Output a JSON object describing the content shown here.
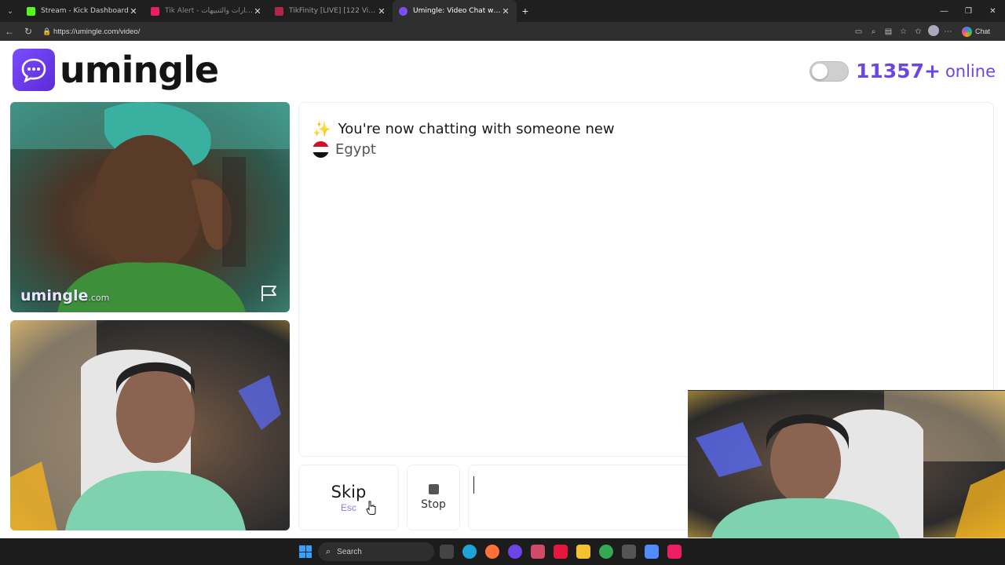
{
  "browser": {
    "tabs": [
      {
        "title": "Stream - Kick Dashboard",
        "icon": "kick-icon",
        "color": "#53fc18",
        "active": false
      },
      {
        "title": "Tik Alert - خدمة الإشعارات والتنبيهات",
        "icon": "tikalert-icon",
        "color": "#e91e63",
        "active": false
      },
      {
        "title": "TikFinity [LIVE] [122 Viewers]",
        "icon": "tikfinity-icon",
        "color": "#ff2d55",
        "active": false
      },
      {
        "title": "Umingle: Video Chat with Str...",
        "icon": "umingle-icon",
        "color": "#7c4dff",
        "active": true
      }
    ],
    "url": "https://umingle.com/video/",
    "copilot_label": "Chat"
  },
  "site": {
    "logo_text": "umingle",
    "online_count": "11357+",
    "online_label": "online",
    "brand_color": "#6b46e6"
  },
  "stranger_video": {
    "watermark": "umingle",
    "watermark_suffix": ".com"
  },
  "chat": {
    "intro_emoji": "✨",
    "intro": "You're now chatting with someone new",
    "country": "Egypt"
  },
  "controls": {
    "skip_label": "Skip",
    "skip_hint": "Esc",
    "stop_label": "Stop",
    "message_value": ""
  },
  "taskbar": {
    "search_label": "Search"
  }
}
